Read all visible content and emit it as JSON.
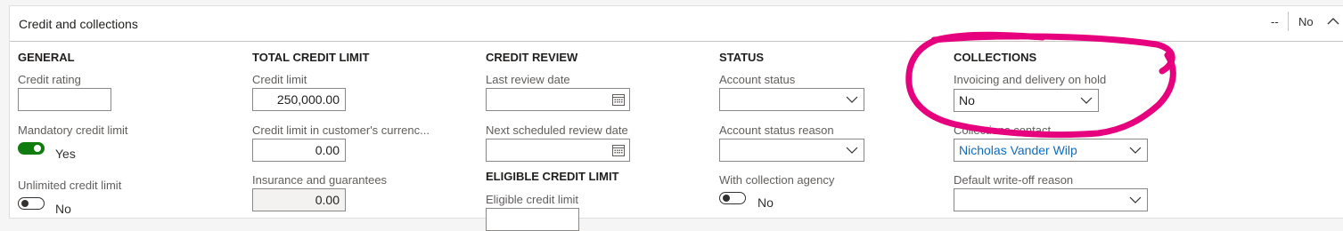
{
  "header": {
    "title": "Credit and collections",
    "summary": "--",
    "value": "No"
  },
  "general": {
    "title": "GENERAL",
    "credit_rating_label": "Credit rating",
    "credit_rating_value": "",
    "mandatory_label": "Mandatory credit limit",
    "mandatory_value": "Yes",
    "unlimited_label": "Unlimited credit limit",
    "unlimited_value": "No"
  },
  "total_credit_limit": {
    "title": "TOTAL CREDIT LIMIT",
    "credit_limit_label": "Credit limit",
    "credit_limit_value": "250,000.00",
    "currency_label": "Credit limit in customer's currenc...",
    "currency_value": "0.00",
    "insurance_label": "Insurance and guarantees",
    "insurance_value": "0.00"
  },
  "credit_review": {
    "title": "CREDIT REVIEW",
    "last_review_label": "Last review date",
    "last_review_value": "",
    "next_review_label": "Next scheduled review date",
    "next_review_value": ""
  },
  "eligible": {
    "title": "ELIGIBLE CREDIT LIMIT",
    "eligible_label": "Eligible credit limit"
  },
  "status": {
    "title": "STATUS",
    "account_status_label": "Account status",
    "account_status_value": "",
    "reason_label": "Account status reason",
    "reason_value": "",
    "agency_label": "With collection agency",
    "agency_value": "No"
  },
  "collections": {
    "title": "COLLECTIONS",
    "hold_label": "Invoicing and delivery on hold",
    "hold_value": "No",
    "contact_label": "Collections contact",
    "contact_value": "Nicholas Vander Wilp",
    "writeoff_label": "Default write-off reason",
    "writeoff_value": ""
  },
  "colors": {
    "toggle_on": "#107c10",
    "link": "#0f6cbd",
    "annotation": "#e6007e"
  }
}
